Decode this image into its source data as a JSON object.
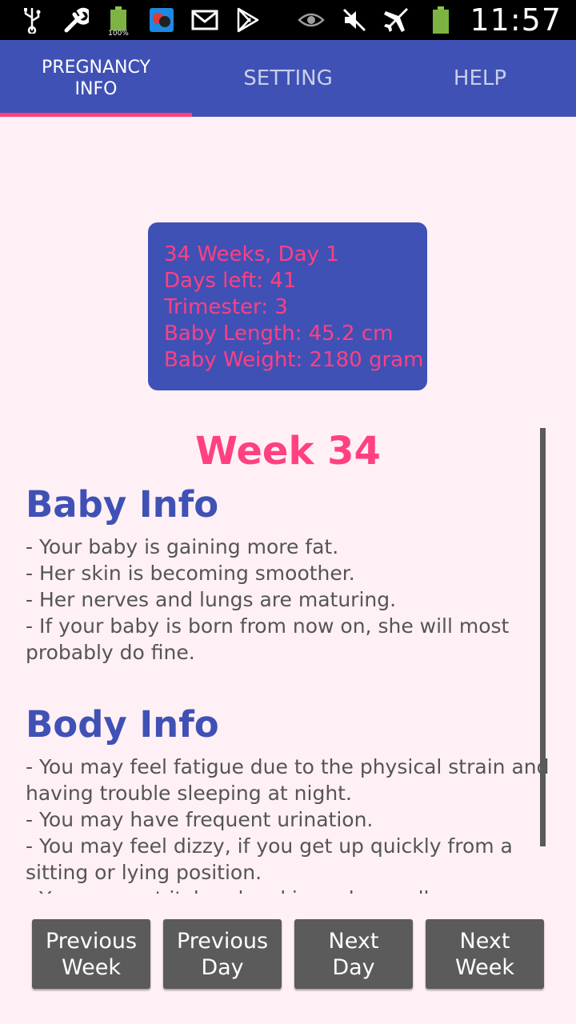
{
  "status_bar": {
    "time": "11:57",
    "battery_left_label": "100%",
    "icons_left": [
      "usb-icon",
      "wrench-icon",
      "battery-full-icon",
      "app-icon",
      "gmail-icon",
      "play-store-icon"
    ],
    "icons_right": [
      "eye-icon",
      "mute-icon",
      "airplane-icon",
      "battery-icon"
    ]
  },
  "tabs": [
    {
      "label": "PREGNANCY\nINFO",
      "active": true
    },
    {
      "label": "SETTING",
      "active": false
    },
    {
      "label": "HELP",
      "active": false
    }
  ],
  "summary": {
    "week_day": "34 Weeks, Day 1",
    "days_left": "Days left: 41",
    "trimester": "Trimester: 3",
    "baby_length": "Baby Length: 45.2 cm",
    "baby_weight": "Baby Weight: 2180 gram"
  },
  "content": {
    "week_title": "Week 34",
    "baby_info_title": "Baby Info",
    "baby_info_lines": [
      "- Your baby is gaining more fat.",
      "- Her skin is becoming smoother.",
      "- Her nerves and lungs are maturing.",
      "- If your baby is born from now on, she will most",
      "probably do fine."
    ],
    "body_info_title": "Body Info",
    "body_info_lines": [
      "- You may feel fatigue due to the physical strain and",
      "having trouble sleeping at night.",
      "- You may have frequent urination.",
      "- You may feel dizzy, if you get up quickly from a",
      "sitting or lying position.",
      "- You may get itchy, dry skin and a swollen"
    ]
  },
  "buttons": {
    "previous_week": "Previous\nWeek",
    "previous_day": "Previous\nDay",
    "next_day": "Next\nDay",
    "next_week": "Next\nWeek"
  },
  "colors": {
    "primary": "#3F51B5",
    "accent": "#FF4081",
    "background": "#FFF0F5",
    "button": "#5B5B5B"
  }
}
